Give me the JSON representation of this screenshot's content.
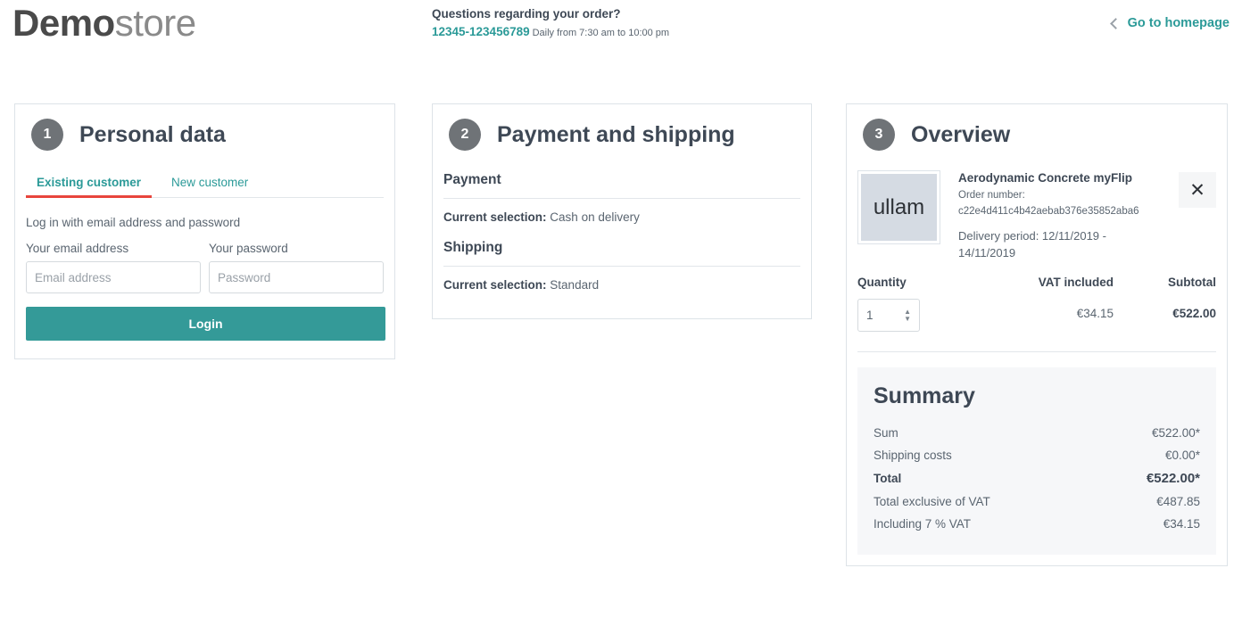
{
  "header": {
    "logo_bold": "Demo",
    "logo_light": "store",
    "contact_title": "Questions regarding your order?",
    "phone": "12345-123456789",
    "hours": "Daily from 7:30 am to 10:00 pm",
    "homepage_link": "Go to homepage",
    "back_icon": "chevron-left-icon"
  },
  "panel1": {
    "step": "1",
    "title": "Personal data",
    "tabs": [
      {
        "label": "Existing customer",
        "active": true
      },
      {
        "label": "New customer",
        "active": false
      }
    ],
    "intro": "Log in with email address and password",
    "email_label": "Your email address",
    "email_placeholder": "Email address",
    "email_value": "",
    "password_label": "Your password",
    "password_placeholder": "Password",
    "password_value": "",
    "login_label": "Login"
  },
  "panel2": {
    "step": "2",
    "title": "Payment and shipping",
    "payment_heading": "Payment",
    "payment_selection_label": "Current selection:",
    "payment_selection_value": "Cash on delivery",
    "shipping_heading": "Shipping",
    "shipping_selection_label": "Current selection:",
    "shipping_selection_value": "Standard"
  },
  "panel3": {
    "step": "3",
    "title": "Overview",
    "product": {
      "thumb_text": "ullam",
      "name": "Aerodynamic Concrete myFlip",
      "order_number_label": "Order number:",
      "order_number": "c22e4d411c4b42aebab376e35852aba6",
      "delivery": "Delivery period: 12/11/2019 - 14/11/2019",
      "remove_icon": "close-icon"
    },
    "table": {
      "quantity_header": "Quantity",
      "vat_header": "VAT included",
      "subtotal_header": "Subtotal",
      "quantity_value": "1",
      "vat_value": "€34.15",
      "subtotal_value": "€522.00"
    },
    "summary": {
      "title": "Summary",
      "rows": [
        {
          "label": "Sum",
          "value": "€522.00*",
          "bold": false
        },
        {
          "label": "Shipping costs",
          "value": "€0.00*",
          "bold": false
        },
        {
          "label": "Total",
          "value": "€522.00*",
          "bold": true
        },
        {
          "label": "Total exclusive of VAT",
          "value": "€487.85",
          "bold": false
        },
        {
          "label": "Including 7 % VAT",
          "value": "€34.15",
          "bold": false
        }
      ]
    }
  },
  "colors": {
    "accent_teal": "#2b9a98",
    "button_teal": "#349a98",
    "tab_underline_red": "#e8453c",
    "step_circle_gray": "#6f7377",
    "heading_dark": "#3e4855",
    "summary_bg": "#f6f7f9"
  }
}
